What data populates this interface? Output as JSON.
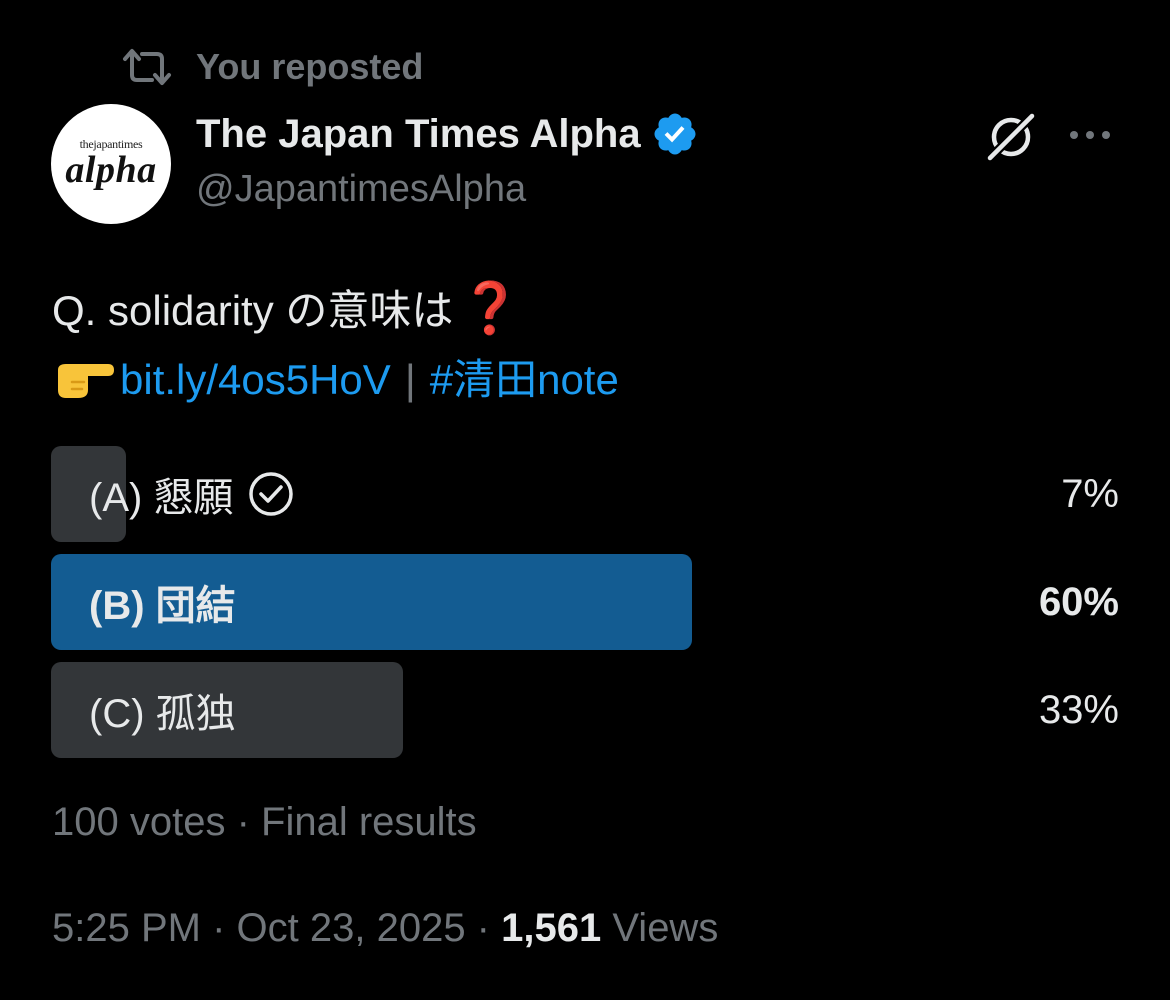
{
  "repost": {
    "icon": "repost-icon",
    "label": "You reposted"
  },
  "author": {
    "avatar_small_text": "thejapantimes",
    "avatar_main_text": "alpha",
    "display_name": "The Japan Times Alpha",
    "verified_icon": "verified-badge-icon",
    "verified_color": "#1d9bf0",
    "handle": "@JapantimesAlpha"
  },
  "actions": {
    "grok_icon": "grok-icon",
    "more_icon": "more-options-icon"
  },
  "tweet": {
    "line1_text": "Q. solidarity の意味は",
    "line1_emoji": "❓",
    "line2_emoji": "pointing-finger-icon",
    "link": "bit.ly/4os5HoV",
    "separator": "|",
    "hashtag": "#清田note"
  },
  "poll": {
    "options": [
      {
        "label": "(A) 懇願",
        "percent_text": "7%",
        "fraction": 0.07,
        "voted": true,
        "winner": false
      },
      {
        "label": "(B) 団結",
        "percent_text": "60%",
        "fraction": 0.6,
        "voted": false,
        "winner": true
      },
      {
        "label": "(C) 孤独",
        "percent_text": "33%",
        "fraction": 0.33,
        "voted": false,
        "winner": false
      }
    ],
    "footer": "100 votes · Final results"
  },
  "meta": {
    "time": "5:25 PM",
    "date": "Oct 23, 2025",
    "dot": " · ",
    "views_count": "1,561",
    "views_label": "Views"
  },
  "colors": {
    "background": "#000000",
    "text": "#e7e9ea",
    "muted": "#71767b",
    "link": "#1d9bf0",
    "bar_winner": "#135c92",
    "bar_default": "#333639"
  }
}
